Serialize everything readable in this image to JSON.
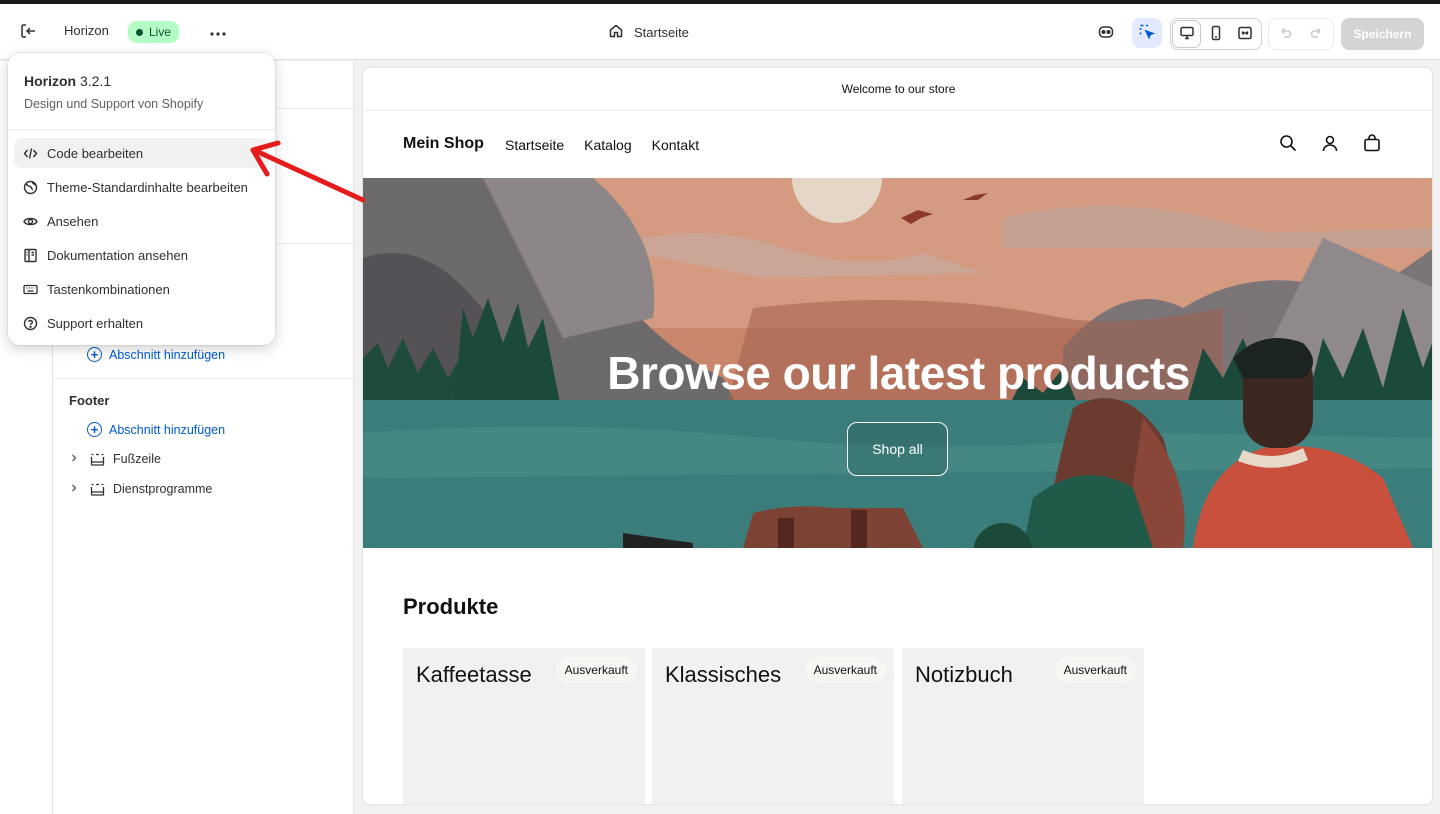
{
  "topbar": {
    "theme_name": "Horizon",
    "status_badge": "Live",
    "page_selector": "Startseite",
    "save_label": "Speichern"
  },
  "menu": {
    "title_name": "Horizon",
    "title_version": "3.2.1",
    "subtitle": "Design und Support von Shopify",
    "items": [
      {
        "label": "Code bearbeiten",
        "icon": "code-icon"
      },
      {
        "label": "Theme-Standardinhalte bearbeiten",
        "icon": "globe-icon"
      },
      {
        "label": "Ansehen",
        "icon": "eye-icon"
      },
      {
        "label": "Dokumentation ansehen",
        "icon": "book-icon"
      },
      {
        "label": "Tastenkombinationen",
        "icon": "keyboard-icon"
      },
      {
        "label": "Support erhalten",
        "icon": "question-icon"
      }
    ]
  },
  "sidebar": {
    "add_section_label": "Abschnitt hinzufügen",
    "footer_heading": "Footer",
    "footer_add_label": "Abschnitt hinzufügen",
    "footer_items": [
      {
        "label": "Fußzeile"
      },
      {
        "label": "Dienstprogramme"
      }
    ]
  },
  "preview": {
    "announcement": "Welcome to our store",
    "store_name": "Mein Shop",
    "nav": [
      "Startseite",
      "Katalog",
      "Kontakt"
    ],
    "hero_title": "Browse our latest products",
    "hero_button": "Shop all",
    "products_heading": "Produkte",
    "products": [
      {
        "name": "Kaffeetasse",
        "badge": "Ausverkauft"
      },
      {
        "name": "Klassisches",
        "badge": "Ausverkauft"
      },
      {
        "name": "Notizbuch",
        "badge": "Ausverkauft"
      }
    ]
  },
  "colors": {
    "accent_blue": "#005bd3",
    "live_badge_bg": "#b4fec6",
    "annotation_arrow": "#e51c1c"
  }
}
